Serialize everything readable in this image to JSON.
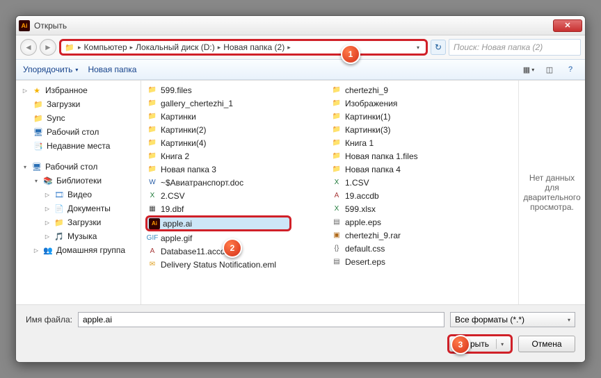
{
  "window": {
    "title": "Открыть"
  },
  "nav": {
    "back_icon": "◄",
    "fwd_icon": "►",
    "refresh_icon": "↻",
    "breadcrumb": [
      "Компьютер",
      "Локальный диск (D:)",
      "Новая папка (2)"
    ],
    "search_placeholder": "Поиск: Новая папка (2)"
  },
  "toolbar": {
    "organize": "Упорядочить",
    "newfolder": "Новая папка",
    "view_icon": "☰",
    "help_icon": "?"
  },
  "sidebar": {
    "favorites": {
      "label": "Избранное",
      "icon": "★"
    },
    "fav_items": [
      {
        "label": "Загрузки",
        "icon_class": "ic-folder",
        "icon": "📁"
      },
      {
        "label": "Sync",
        "icon_class": "ic-sync",
        "icon": "📁"
      },
      {
        "label": "Рабочий стол",
        "icon_class": "ic-desktop",
        "icon": "🖥"
      },
      {
        "label": "Недавние места",
        "icon_class": "ic-places",
        "icon": "📑"
      }
    ],
    "desktop": {
      "label": "Рабочий стол",
      "icon": "🖥"
    },
    "libraries": {
      "label": "Библиотеки",
      "icon": "📚"
    },
    "lib_items": [
      {
        "label": "Видео",
        "icon_class": "ic-video",
        "icon": "🎞"
      },
      {
        "label": "Документы",
        "icon_class": "ic-doc",
        "icon": "📄"
      },
      {
        "label": "Загрузки",
        "icon_class": "ic-down",
        "icon": "📁"
      },
      {
        "label": "Музыка",
        "icon_class": "ic-music",
        "icon": "🎵"
      }
    ],
    "homegroup": {
      "label": "Домашняя группа",
      "icon": "👥"
    }
  },
  "files": {
    "col1": [
      {
        "name": "599.files",
        "type": "folder"
      },
      {
        "name": "gallery_chertezhi_1",
        "type": "folder"
      },
      {
        "name": "Картинки",
        "type": "folder"
      },
      {
        "name": "Картинки(2)",
        "type": "folder"
      },
      {
        "name": "Картинки(4)",
        "type": "folder"
      },
      {
        "name": "Книга 2",
        "type": "folder"
      },
      {
        "name": "Новая папка 3",
        "type": "folder"
      },
      {
        "name": "~$Авиатранспорт.doc",
        "type": "word"
      },
      {
        "name": "2.CSV",
        "type": "xls"
      },
      {
        "name": "19.dbf",
        "type": "dbf"
      },
      {
        "name": "apple.ai",
        "type": "ai",
        "selected": true
      },
      {
        "name": "apple.gif",
        "type": "gif"
      },
      {
        "name": "Database11.accdb",
        "type": "accdb"
      },
      {
        "name": "Delivery Status Notification.eml",
        "type": "eml"
      }
    ],
    "col2": [
      {
        "name": "chertezhi_9",
        "type": "folder"
      },
      {
        "name": "Изображения",
        "type": "folder"
      },
      {
        "name": "Картинки(1)",
        "type": "folder"
      },
      {
        "name": "Картинки(3)",
        "type": "folder"
      },
      {
        "name": "Книга 1",
        "type": "folder"
      },
      {
        "name": "Новая папка 1.files",
        "type": "folder"
      },
      {
        "name": "Новая папка 4",
        "type": "folder"
      },
      {
        "name": "1.CSV",
        "type": "xls"
      },
      {
        "name": "19.accdb",
        "type": "accdb"
      },
      {
        "name": "599.xlsx",
        "type": "xls"
      },
      {
        "name": "apple.eps",
        "type": "eps"
      },
      {
        "name": "chertezhi_9.rar",
        "type": "rar"
      },
      {
        "name": "default.css",
        "type": "css"
      },
      {
        "name": "Desert.eps",
        "type": "eps"
      }
    ]
  },
  "preview": {
    "text": "Нет данных для дварительного просмотра."
  },
  "bottom": {
    "filename_label": "Имя файла:",
    "filename_value": "apple.ai",
    "filter_label": "Все форматы (*.*)",
    "open_label": "Открыть",
    "cancel_label": "Отмена"
  },
  "markers": {
    "m1": "1",
    "m2": "2",
    "m3": "3"
  },
  "icon_map": {
    "folder": {
      "cls": "fic-folder",
      "glyph": "📁"
    },
    "word": {
      "cls": "fic-word",
      "glyph": "W"
    },
    "xls": {
      "cls": "fic-xls",
      "glyph": "X"
    },
    "dbf": {
      "cls": "fic-dbf",
      "glyph": "▦"
    },
    "ai": {
      "cls": "fic-ai",
      "glyph": "Ai"
    },
    "gif": {
      "cls": "fic-gif",
      "glyph": "GIF"
    },
    "accdb": {
      "cls": "fic-accdb",
      "glyph": "A"
    },
    "eml": {
      "cls": "fic-eml",
      "glyph": "✉"
    },
    "eps": {
      "cls": "fic-eps",
      "glyph": "▤"
    },
    "rar": {
      "cls": "fic-rar",
      "glyph": "▣"
    },
    "css": {
      "cls": "fic-css",
      "glyph": "{}"
    },
    "jpg": {
      "cls": "fic-jpg",
      "glyph": "▤"
    }
  }
}
